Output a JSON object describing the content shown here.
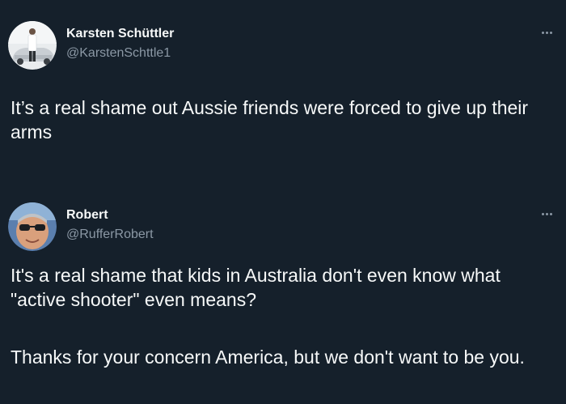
{
  "tweets": [
    {
      "name": "Karsten Schüttler",
      "handle": "@KarstenSchttle1",
      "paragraphs": [
        "It’s a real shame out Aussie friends were forced to give up their arms"
      ]
    },
    {
      "name": "Robert",
      "handle": "@RufferRobert",
      "paragraphs": [
        "It's a real shame that kids in Australia don't even know what \"active shooter\" even means?",
        "Thanks for your concern America, but we don't want to be you."
      ]
    }
  ],
  "colors": {
    "background": "#15202b",
    "text": "#f7f9f9",
    "secondary": "#8b98a5"
  },
  "icons": {
    "more": "more-horizontal-icon"
  }
}
